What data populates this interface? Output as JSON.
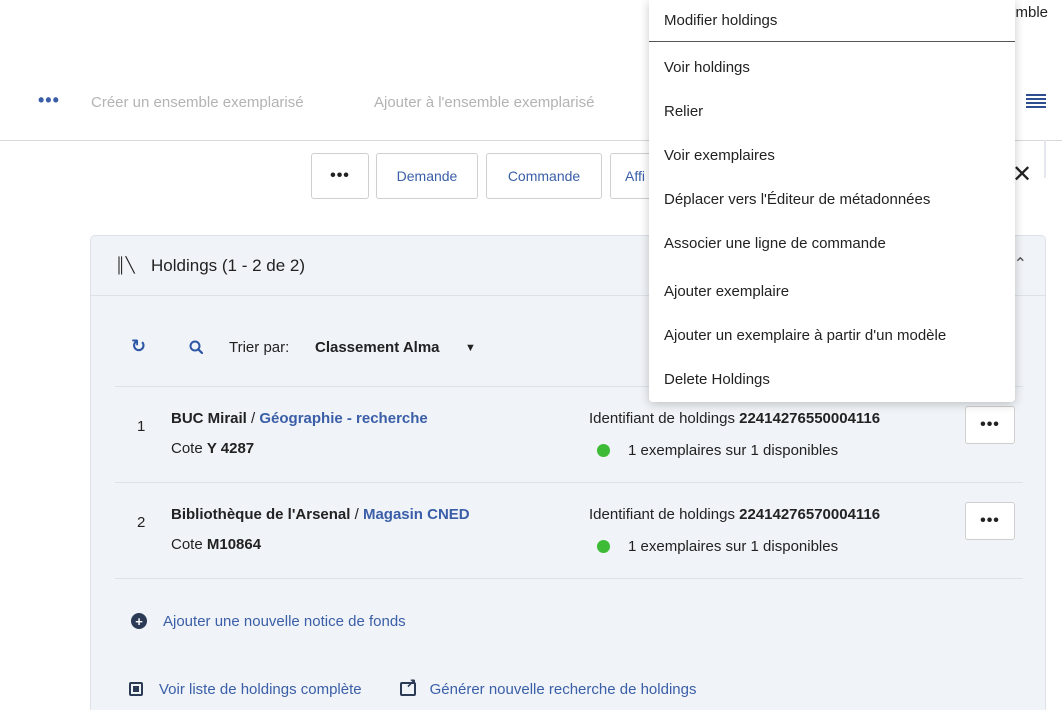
{
  "top_partial_text": "mble",
  "toolbar": {
    "more_label": "•••",
    "create_set": "Créer un ensemble exemplarisé",
    "add_to_set": "Ajouter à l'ensemble exemplarisé"
  },
  "actions": {
    "more_label": "•••",
    "request": "Demande",
    "order": "Commande",
    "partial": "Affi",
    "close": "✕"
  },
  "panel": {
    "title": "Holdings (1 - 2 de 2)",
    "sort_label": "Trier par:",
    "sort_value": "Classement Alma",
    "sort_caret": "▼",
    "add_new": "Ajouter une nouvelle notice de fonds",
    "view_full_list": "Voir liste de holdings complète",
    "new_search": "Générer nouvelle recherche de holdings"
  },
  "holdings": [
    {
      "num": "1",
      "library": "BUC Mirail",
      "sep": " / ",
      "location": "Géographie - recherche",
      "cote_label": "Cote ",
      "cote_value": "Y 4287",
      "id_label": "Identifiant de holdings ",
      "id_value": "22414276550004116",
      "availability": "1 exemplaires sur 1 disponibles",
      "more_label": "•••"
    },
    {
      "num": "2",
      "library": "Bibliothèque de l'Arsenal",
      "sep": " / ",
      "location": "Magasin CNED",
      "cote_label": "Cote ",
      "cote_value": "M10864",
      "id_label": "Identifiant de holdings ",
      "id_value": "22414276570004116",
      "availability": "1 exemplaires sur 1 disponibles",
      "more_label": "•••"
    }
  ],
  "menu": {
    "items": [
      "Modifier holdings",
      "Voir holdings",
      "Relier",
      "Voir exemplaires",
      "Déplacer vers l'Éditeur de métadonnées",
      "Associer une ligne de commande",
      "Ajouter exemplaire",
      "Ajouter un exemplaire à partir d'un modèle",
      "Delete Holdings"
    ]
  },
  "colors": {
    "link": "#3a5fa8",
    "available": "#3dbb36",
    "panel_bg": "#f0f3f7"
  }
}
